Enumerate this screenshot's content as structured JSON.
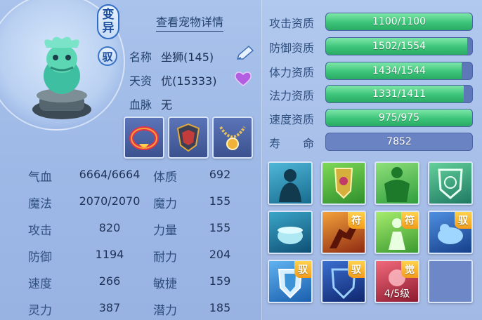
{
  "pet": {
    "variant_badge_top": "变",
    "variant_badge_bottom": "异",
    "tame_badge": "驭",
    "detail_link": "查看宠物详情",
    "name_label": "名称",
    "name_value": "坐狮(145)",
    "talent_label": "天资",
    "talent_value": "优(15333)",
    "bloodline_label": "血脉",
    "bloodline_value": "无"
  },
  "equipment": [
    {
      "icon": "collar-icon"
    },
    {
      "icon": "armor-icon"
    },
    {
      "icon": "necklace-icon"
    }
  ],
  "stats": [
    {
      "l1": "气血",
      "v1": "6664/6664",
      "l2": "体质",
      "v2": "692"
    },
    {
      "l1": "魔法",
      "v1": "2070/2070",
      "l2": "魔力",
      "v2": "155"
    },
    {
      "l1": "攻击",
      "v1": "820",
      "l2": "力量",
      "v2": "155"
    },
    {
      "l1": "防御",
      "v1": "1194",
      "l2": "耐力",
      "v2": "204"
    },
    {
      "l1": "速度",
      "v1": "266",
      "l2": "敏捷",
      "v2": "159"
    },
    {
      "l1": "灵力",
      "v1": "387",
      "l2": "潜力",
      "v2": "185"
    }
  ],
  "aptitudes": [
    {
      "name": "攻击资质",
      "text": "1100/1100",
      "fraction": 1.0
    },
    {
      "name": "防御资质",
      "text": "1502/1554",
      "fraction": 0.966
    },
    {
      "name": "体力资质",
      "text": "1434/1544",
      "fraction": 0.929
    },
    {
      "name": "法力资质",
      "text": "1331/1411",
      "fraction": 0.943
    },
    {
      "name": "速度资质",
      "text": "975/975",
      "fraction": 1.0
    },
    {
      "name": "寿　　命",
      "text": "7852",
      "fraction": 0
    }
  ],
  "skills": [
    {
      "icon": "shadow-figure-skill-icon",
      "tag": ""
    },
    {
      "icon": "shield-emblem-skill-icon",
      "tag": ""
    },
    {
      "icon": "green-muscle-skill-icon",
      "tag": ""
    },
    {
      "icon": "green-shield-skill-icon",
      "tag": ""
    },
    {
      "icon": "cauldron-skill-icon",
      "tag": ""
    },
    {
      "icon": "red-warrior-skill-icon",
      "tag": "符"
    },
    {
      "icon": "green-figure-skill-icon",
      "tag": "符"
    },
    {
      "icon": "blue-beast-skill-icon",
      "tag": "驭"
    },
    {
      "icon": "blue-shield-skill-icon",
      "tag": "驭"
    },
    {
      "icon": "dark-shield-skill-icon",
      "tag": "驭"
    },
    {
      "icon": "red-aura-skill-icon",
      "tag": "觉",
      "level": "4/5级"
    },
    {
      "icon": "empty-slot",
      "tag": ""
    }
  ],
  "colors": {
    "bar_fill": "#3cc47a",
    "bar_track": "#5d77b8",
    "tag_gold": "#f29b1a"
  }
}
